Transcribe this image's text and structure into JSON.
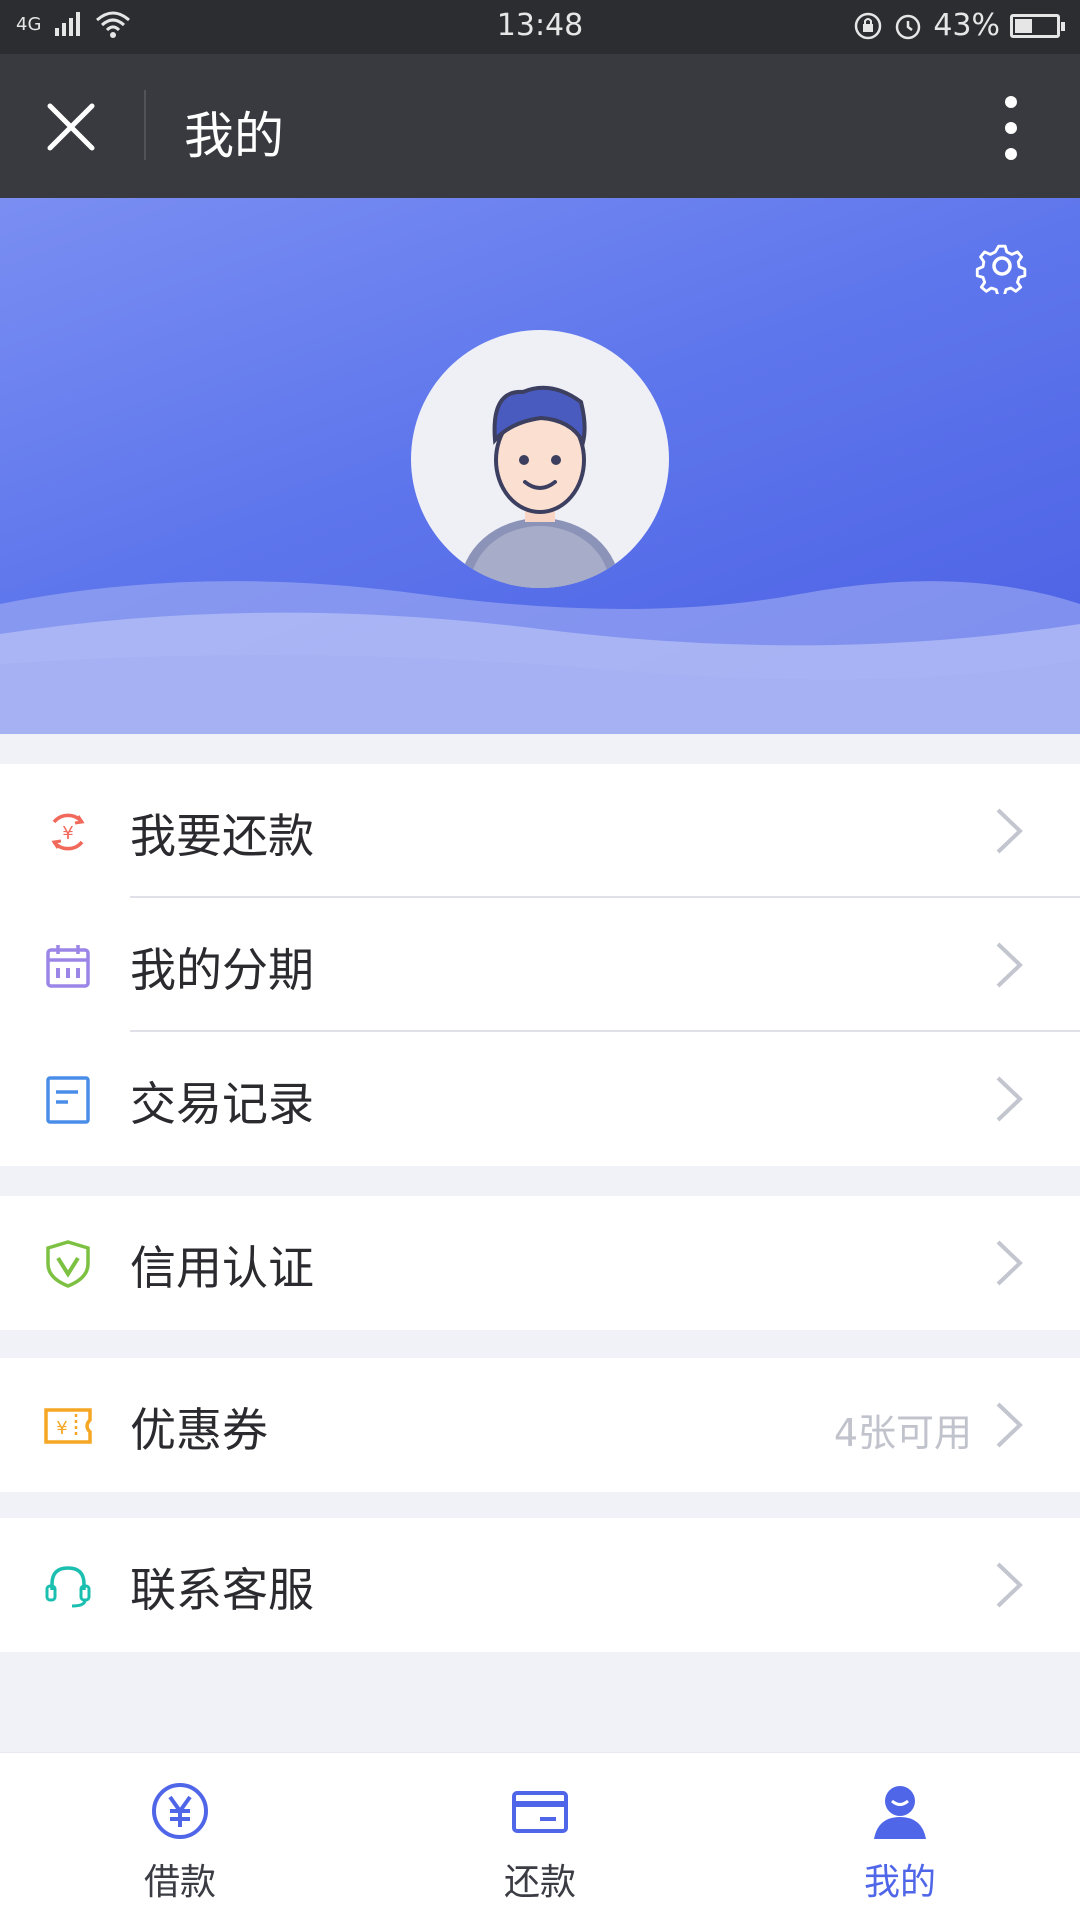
{
  "status_bar": {
    "network": "4G",
    "time": "13:48",
    "battery": "43%",
    "battery_level": 0.43
  },
  "title_bar": {
    "title": "我的"
  },
  "menu": [
    {
      "label": "我要还款",
      "icon": "repay-yen-icon"
    },
    {
      "label": "我的分期",
      "icon": "calendar-icon"
    },
    {
      "label": "交易记录",
      "icon": "document-icon"
    },
    {
      "label": "信用认证",
      "icon": "shield-check-icon"
    },
    {
      "label": "优惠券",
      "icon": "coupon-icon",
      "extra": "4张可用"
    },
    {
      "label": "联系客服",
      "icon": "headset-icon"
    }
  ],
  "tabs": [
    {
      "label": "借款",
      "icon": "yen-circle-icon"
    },
    {
      "label": "还款",
      "icon": "card-icon"
    },
    {
      "label": "我的",
      "icon": "user-icon",
      "active": true
    }
  ],
  "colors": {
    "accent": "#5066e8",
    "title_bar": "#393a3f",
    "status_bar": "#2c2d31"
  }
}
